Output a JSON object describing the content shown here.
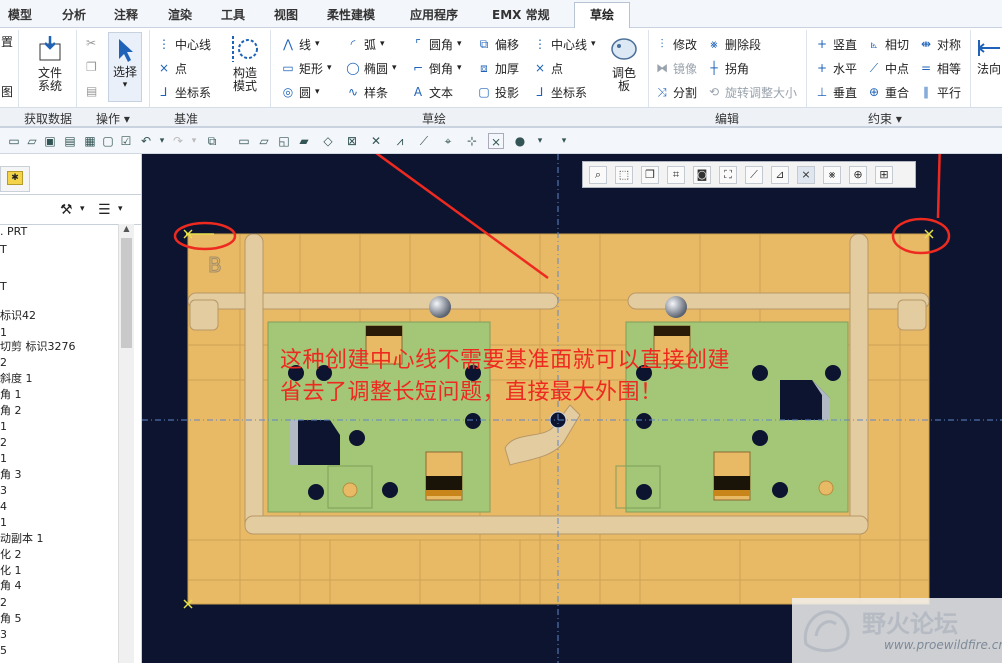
{
  "tabs": [
    "模型",
    "分析",
    "注释",
    "渲染",
    "工具",
    "视图",
    "柔性建模",
    "应用程序",
    "EMX 常规"
  ],
  "active_tab": "草绘",
  "ribbon": {
    "left_partial_1": "置",
    "left_partial_2": "图",
    "file_system": [
      "文件",
      "系统"
    ],
    "select_label": "选择",
    "centerline_label": "中心线",
    "point_label": "点",
    "coord_label": "坐标系",
    "construct_mode": [
      "构造",
      "模式"
    ],
    "line_label": "线",
    "rect_label": "矩形",
    "circle_label": "圆",
    "arc_label": "弧",
    "ellipse_label": "椭圆",
    "spline_label": "样条",
    "fillet_label": "圆角",
    "chamfer_label": "倒角",
    "text_label": "文本",
    "offset_label": "偏移",
    "thicken_label": "加厚",
    "project_label": "投影",
    "centerline2_label": "中心线",
    "point2_label": "点",
    "coord2_label": "坐标系",
    "palette": [
      "调色",
      "板"
    ],
    "modify_label": "修改",
    "delete_seg_label": "删除段",
    "mirror_label": "镜像",
    "corner_label": "拐角",
    "divide_label": "分割",
    "rotate_resize_label": "旋转调整大小",
    "vertical_label": "竖直",
    "tangent_label": "相切",
    "symmetric_label": "对称",
    "horizontal_label": "水平",
    "midpoint_label": "中点",
    "equal_label": "相等",
    "perpendicular_label": "垂直",
    "coincident_label": "重合",
    "parallel_label": "平行",
    "normal_partial": "法向"
  },
  "groups": {
    "get_data": "获取数据",
    "operations": "操作",
    "datum": "基准",
    "sketch": "草绘",
    "edit": "编辑",
    "constraints": "约束"
  },
  "tree": {
    "items": [
      ". PRT",
      "T",
      "",
      "T",
      "",
      "标识42",
      "1",
      "切剪 标识3276",
      "2",
      "斜度 1",
      "角 1",
      "角 2",
      "1",
      "2",
      "1",
      "角 3",
      "3",
      "4",
      "1",
      "动副本 1",
      "化 2",
      "化 1",
      "角 4",
      "2",
      "角 5",
      "3",
      "5"
    ]
  },
  "annotation": {
    "line1": "这种创建中心线不需要基准面就可以直接创建",
    "line2": "省去了调整长短问题，直接最大外围！"
  },
  "watermark": {
    "title": "野火论坛",
    "url": "www.proewildfire.cn"
  },
  "colors": {
    "annotation": "#ee2a20",
    "canvas_bg": "#0c1430",
    "plate": "#e9ba66",
    "pcb": "#a3c777"
  }
}
